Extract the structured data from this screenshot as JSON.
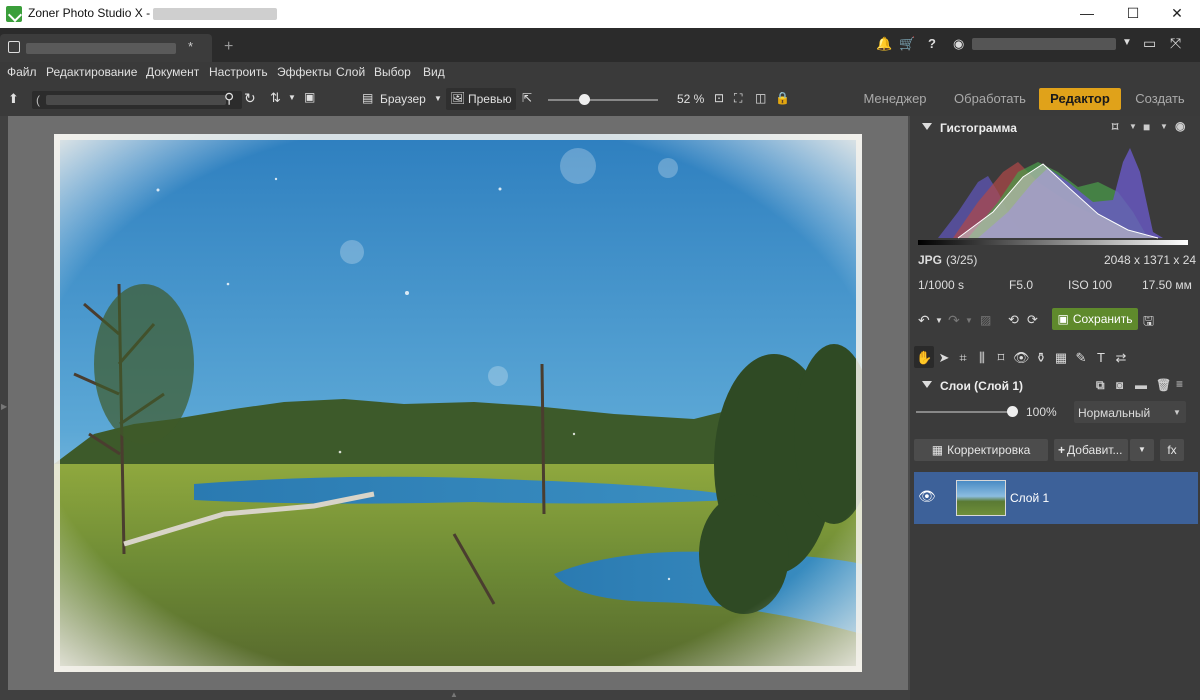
{
  "window": {
    "title_prefix": "Zoner Photo Studio X -",
    "minimize": "—",
    "maximize": "☐",
    "close": "✕"
  },
  "tabs": {
    "close_glyph": "*",
    "new_tab": "+"
  },
  "top_icons": [
    "bell-icon",
    "cart-icon",
    "help-icon",
    "user-icon",
    "chevron-down-icon",
    "monitor-icon",
    "fullscreen-icon"
  ],
  "top_icon_glyphs": {
    "bell": "🔔",
    "cart": "🛒",
    "help": "?",
    "user": "◉",
    "caret": "▼",
    "monitor": "▭",
    "fullscreen": "⤧"
  },
  "menu": [
    "Файл",
    "Редактирование",
    "Документ",
    "Настроить",
    "Эффекты",
    "Слой",
    "Выбор",
    "Вид"
  ],
  "toolbar": {
    "path_text": "(",
    "browser_label": "Браузер",
    "preview_label": "Превью",
    "zoom_label": "52 %",
    "zoom_fraction": 0.33
  },
  "modes": [
    {
      "label": "Менеджер",
      "active": false
    },
    {
      "label": "Обработать",
      "active": false
    },
    {
      "label": "Редактор",
      "active": true
    },
    {
      "label": "Создать",
      "active": false
    }
  ],
  "histogram": {
    "title": "Гистограмма"
  },
  "photo_info": {
    "format": "JPG",
    "index": "(3/25)",
    "dimensions": "2048 x 1371 x 24",
    "shutter": "1/1000 s",
    "aperture": "F5.0",
    "iso": "ISO 100",
    "focal": "17.50 мм"
  },
  "actions": {
    "save_label": "Сохранить"
  },
  "layers": {
    "title": "Слои (Слой 1)",
    "opacity": "100%",
    "opacity_fraction": 1.0,
    "blend_mode": "Нормальный",
    "correction_label": "Корректировка",
    "add_label": "Добавит...",
    "fx_label": "fx",
    "items": [
      {
        "name": "Слой 1",
        "selected": true
      }
    ]
  },
  "colors": {
    "accent_mode": "#e0a21a",
    "save_button": "#5f8a2c",
    "selected_layer": "#3d6199"
  }
}
